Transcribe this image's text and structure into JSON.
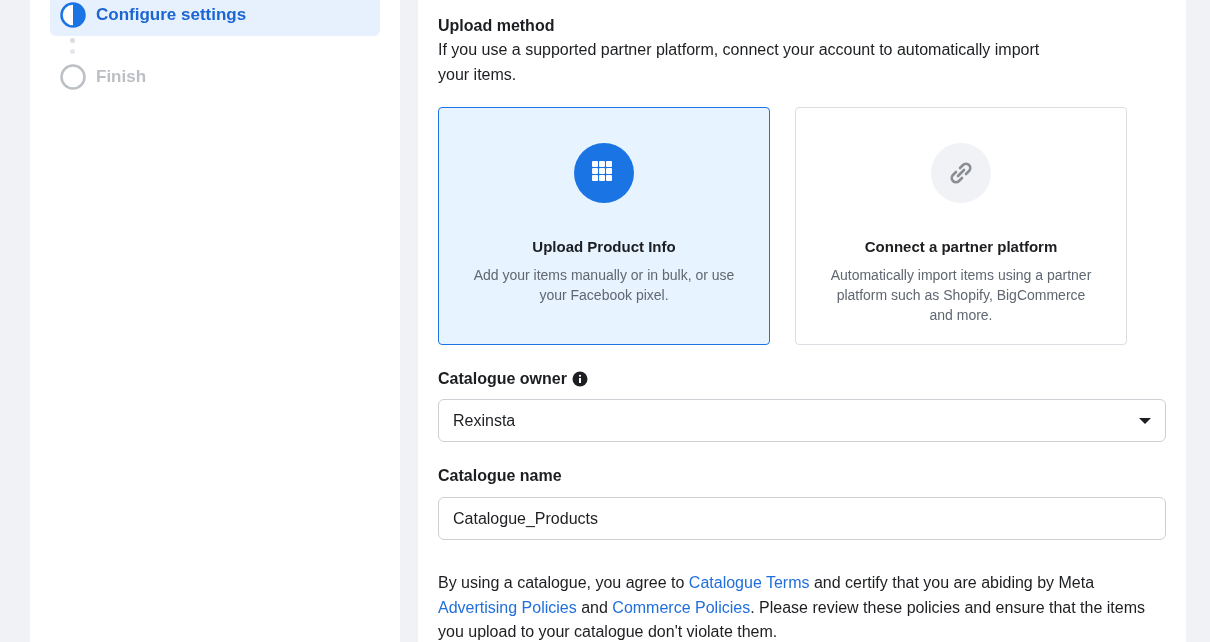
{
  "steps": [
    {
      "label": "Configure settings",
      "kind": "current",
      "selected": true
    },
    {
      "label": "Finish",
      "kind": "upcoming",
      "selected": false
    }
  ],
  "upload_method": {
    "title": "Upload method",
    "description": "If you use a supported partner platform, connect your account to automatically import your items.",
    "options": [
      {
        "kind": "grid",
        "title": "Upload Product Info",
        "description": "Add your items manually or in bulk, or use your Facebook pixel.",
        "selected": true
      },
      {
        "kind": "link",
        "title": "Connect a partner platform",
        "description": "Automatically import items using a partner platform such as Shopify, BigCommerce and more.",
        "selected": false
      }
    ]
  },
  "catalogue_owner": {
    "label": "Catalogue owner",
    "value": "Rexinsta"
  },
  "catalogue_name": {
    "label": "Catalogue name",
    "value": "Catalogue_Products"
  },
  "terms": [
    {
      "kind": "text",
      "text": "By using a catalogue, you agree to "
    },
    {
      "kind": "link",
      "text": "Catalogue Terms"
    },
    {
      "kind": "text",
      "text": " and certify that you are abiding by Meta "
    },
    {
      "kind": "link",
      "text": "Advertising Policies"
    },
    {
      "kind": "text",
      "text": " and "
    },
    {
      "kind": "link",
      "text": "Commerce Policies"
    },
    {
      "kind": "text",
      "text": ". Please review these policies and ensure that the items you upload to your catalogue don't violate them."
    }
  ]
}
